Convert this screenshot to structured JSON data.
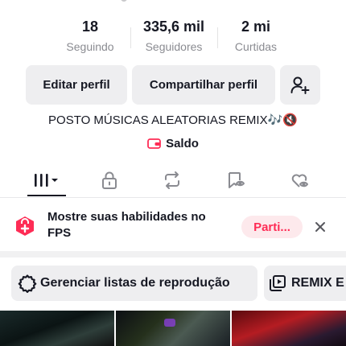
{
  "stats": [
    {
      "value": "18",
      "label": "Seguindo"
    },
    {
      "value": "335,6 mil",
      "label": "Seguidores"
    },
    {
      "value": "2 mi",
      "label": "Curtidas"
    }
  ],
  "actions": {
    "edit_profile": "Editar perfil",
    "share_profile": "Compartilhar perfil",
    "add_friends_icon": "add-user-icon"
  },
  "bio": "POSTO MÚSICAS ALEATORIAS REMIX🎶🔇",
  "balance": {
    "label": "Saldo",
    "icon": "wallet-icon"
  },
  "tabs": [
    {
      "icon": "grid-videos-icon",
      "active": true
    },
    {
      "icon": "lock-icon",
      "active": false
    },
    {
      "icon": "repost-icon",
      "active": false
    },
    {
      "icon": "bookmark-hidden-icon",
      "active": false
    },
    {
      "icon": "liked-hidden-icon",
      "active": false
    }
  ],
  "banner": {
    "text": "Mostre suas habilidades no FPS",
    "button": "Parti...",
    "icon": "game-icon"
  },
  "playlists": {
    "manage": "Gerenciar listas de reprodução",
    "playlist_name": "REMIX E"
  },
  "colors": {
    "accent": "#fe2c55",
    "text": "#161823",
    "muted": "#8a8b91"
  }
}
